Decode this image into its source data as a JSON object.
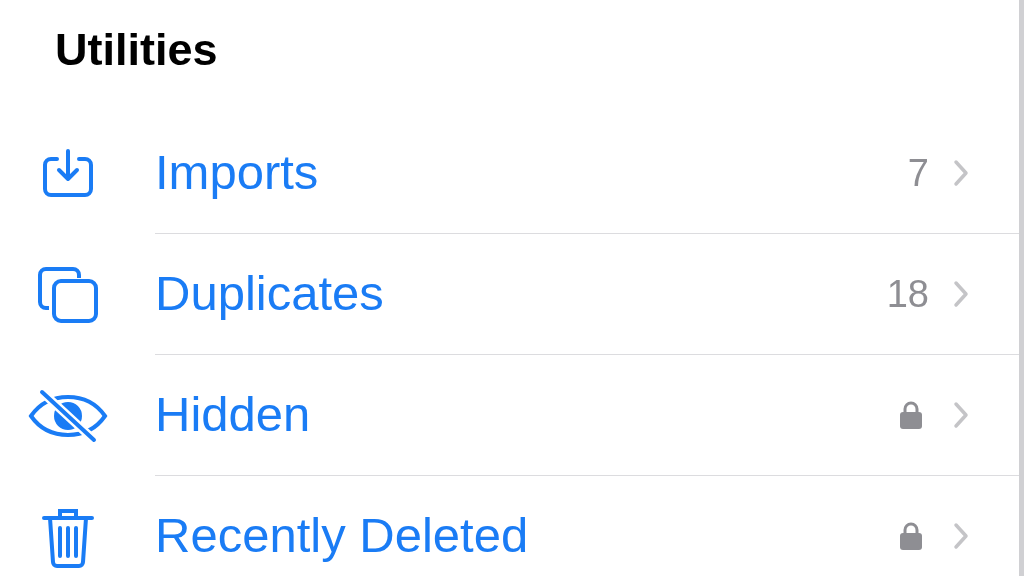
{
  "section": {
    "title": "Utilities"
  },
  "rows": [
    {
      "label": "Imports",
      "count": "7",
      "locked": false
    },
    {
      "label": "Duplicates",
      "count": "18",
      "locked": false
    },
    {
      "label": "Hidden",
      "locked": true
    },
    {
      "label": "Recently Deleted",
      "locked": true
    }
  ]
}
